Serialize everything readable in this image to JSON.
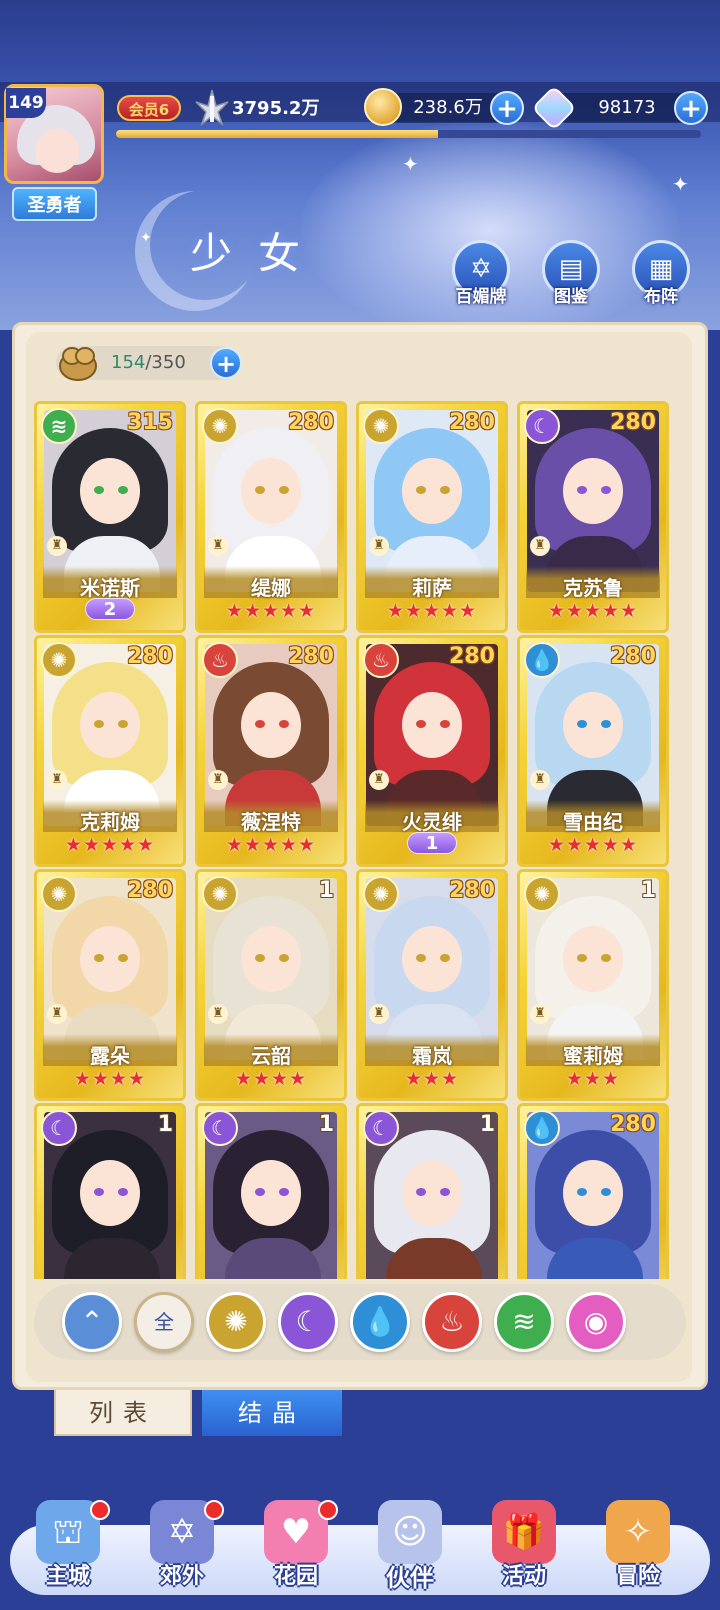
{
  "header": {
    "level": "149",
    "title_badge": "圣勇者",
    "vip": "会员6",
    "power": "3795.2万",
    "exp_fraction": 0.55,
    "gold": "238.6万",
    "gems": "98173",
    "plus": "+"
  },
  "page_title": "少女",
  "quick_buttons": [
    {
      "label": "百媚牌",
      "icon": "card-deck-icon"
    },
    {
      "label": "图鉴",
      "icon": "book-icon"
    },
    {
      "label": "布阵",
      "icon": "formation-grid-icon"
    }
  ],
  "capacity": {
    "current": "154",
    "max": "/350"
  },
  "characters": [
    {
      "name": "米诺斯",
      "level": "315",
      "element": "wind",
      "stars": "",
      "awaken": "2"
    },
    {
      "name": "缇娜",
      "level": "280",
      "element": "light",
      "stars": "★★★★★",
      "awaken": ""
    },
    {
      "name": "莉萨",
      "level": "280",
      "element": "light",
      "stars": "★★★★★",
      "awaken": ""
    },
    {
      "name": "克苏鲁",
      "level": "280",
      "element": "dark",
      "stars": "★★★★★",
      "awaken": ""
    },
    {
      "name": "克莉姆",
      "level": "280",
      "element": "light",
      "stars": "★★★★★",
      "awaken": ""
    },
    {
      "name": "薇涅特",
      "level": "280",
      "element": "fire",
      "stars": "★★★★★",
      "awaken": ""
    },
    {
      "name": "火灵绯",
      "level": "280",
      "element": "fire",
      "stars": "",
      "awaken": "1"
    },
    {
      "name": "雪由纪",
      "level": "280",
      "element": "water",
      "stars": "★★★★★",
      "awaken": ""
    },
    {
      "name": "露朵",
      "level": "280",
      "element": "light",
      "stars": "★★★★",
      "awaken": ""
    },
    {
      "name": "云韶",
      "level": "1",
      "element": "light",
      "stars": "★★★★",
      "awaken": ""
    },
    {
      "name": "霜岚",
      "level": "280",
      "element": "light",
      "stars": "★★★",
      "awaken": ""
    },
    {
      "name": "蜜莉姆",
      "level": "1",
      "element": "light",
      "stars": "★★★",
      "awaken": ""
    },
    {
      "name": "",
      "level": "1",
      "element": "dark",
      "stars": "",
      "awaken": ""
    },
    {
      "name": "",
      "level": "1",
      "element": "dark",
      "stars": "",
      "awaken": ""
    },
    {
      "name": "",
      "level": "1",
      "element": "dark",
      "stars": "",
      "awaken": ""
    },
    {
      "name": "",
      "level": "280",
      "element": "water",
      "stars": "",
      "awaken": ""
    }
  ],
  "element_colors": {
    "wind": "#3fae4e",
    "light": "#c9a431",
    "dark": "#8a55d6",
    "fire": "#d8443c",
    "water": "#2f8fd6"
  },
  "filters": [
    {
      "id": "collapse",
      "label": "",
      "icon": "collapse-up-icon",
      "color": "#5a8ed6"
    },
    {
      "id": "all",
      "label": "全",
      "icon": "moon-all-icon",
      "color": "#f4efe6"
    },
    {
      "id": "light",
      "label": "",
      "icon": "sun-icon",
      "color": "#c9a431"
    },
    {
      "id": "dark",
      "label": "",
      "icon": "crescent-icon",
      "color": "#8a55d6"
    },
    {
      "id": "water",
      "label": "",
      "icon": "water-drop-icon",
      "color": "#2f8fd6"
    },
    {
      "id": "fire",
      "label": "",
      "icon": "flame-icon",
      "color": "#d8443c"
    },
    {
      "id": "wind",
      "label": "",
      "icon": "tornado-icon",
      "color": "#3fae4e"
    },
    {
      "id": "pink",
      "label": "",
      "icon": "orb-icon",
      "color": "#e35ec0"
    }
  ],
  "tabs": {
    "list": "列表",
    "crystal": "结晶"
  },
  "bottom_nav": [
    {
      "label": "主城",
      "icon": "castle-icon",
      "badge": true
    },
    {
      "label": "郊外",
      "icon": "hexagram-gate-icon",
      "badge": true
    },
    {
      "label": "花园",
      "icon": "heart-garden-icon",
      "badge": true
    },
    {
      "label": "伙伴",
      "icon": "partner-portrait-icon",
      "badge": false
    },
    {
      "label": "活动",
      "icon": "gift-box-icon",
      "badge": false
    },
    {
      "label": "冒险",
      "icon": "compass-icon",
      "badge": false
    }
  ]
}
